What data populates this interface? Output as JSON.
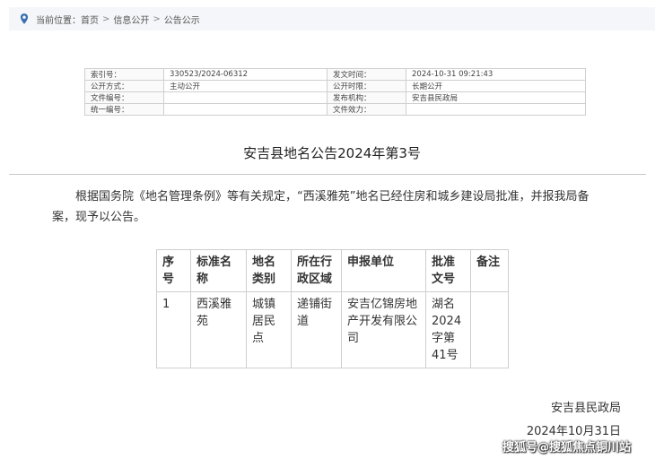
{
  "breadcrumb": {
    "label": "当前位置：",
    "items": [
      "首页",
      "信息公开",
      "公告公示"
    ],
    "separator": ">"
  },
  "meta_table": {
    "rows": [
      [
        "索引号：",
        "330523/2024-06312",
        "发文时间：",
        "2024-10-31 09:21:43"
      ],
      [
        "公开方式：",
        "主动公开",
        "公开时限：",
        "长期公开"
      ],
      [
        "文件编号：",
        "",
        "发布机构：",
        "安吉县民政局"
      ],
      [
        "统一编号：",
        "",
        "文件效力：",
        ""
      ]
    ]
  },
  "document": {
    "title": "安吉县地名公告2024年第3号",
    "body": "根据国务院《地名管理条例》等有关规定，“西溪雅苑”地名已经住房和城乡建设局批准，并报我局备案，现予以公告。"
  },
  "name_table": {
    "headers": [
      "序号",
      "标准名称",
      "地名类别",
      "所在行政区域",
      "申报单位",
      "批准文号",
      "备注"
    ],
    "rows": [
      [
        "1",
        "西溪雅苑",
        "城镇居民点",
        "递铺街道",
        "安吉亿锦房地产开发有限公司",
        "湖名2024字第41号",
        ""
      ]
    ]
  },
  "signature": {
    "org": "安吉县民政局",
    "date": "2024年10月31日"
  },
  "watermark": "搜狐号@搜狐焦点铜川站",
  "colors": {
    "breadcrumb_bg": "#f4f6f9",
    "pin": "#3a6fb0"
  }
}
